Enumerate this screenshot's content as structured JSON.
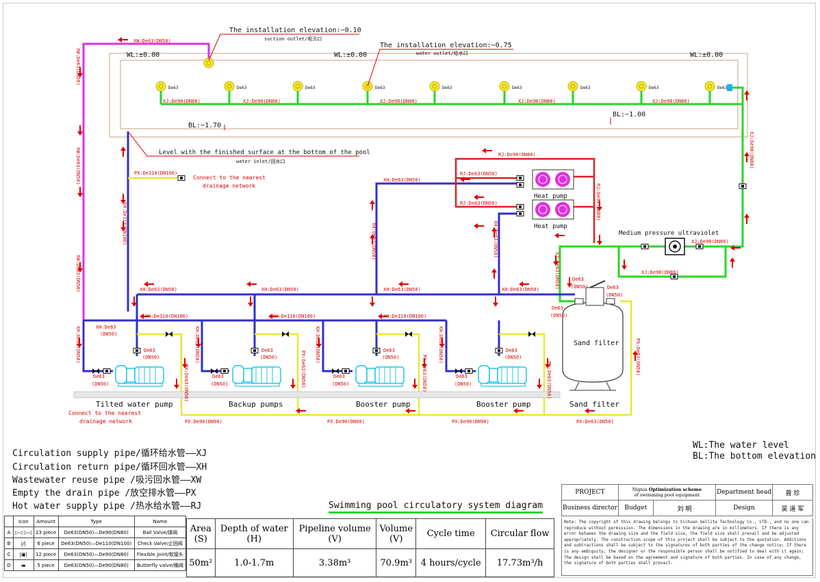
{
  "diagram": {
    "elev_suction": "The installation elevation:−0.10",
    "suction_outlet": "suction outlet/吸污口",
    "elev_water_outlet": "The installation elevation:−0.75",
    "water_outlet": "water outlet/给水口",
    "wl": "WL:±0.00",
    "bl_170": "BL:−1.70",
    "bl_100": "BL:−1.00",
    "level_note": "Level with the finished surface at the bottom of the pool",
    "water_inlet": "water inlet/回水口",
    "xw_top": "XW:De63(DN50)",
    "xw_left": "XW:De63(DN50)",
    "de63": "De63",
    "xj_de90": "XJ:De90(DN80)",
    "px_de110": "PX:De110(DN100)",
    "drain_connect": "Connect to the nearest",
    "drain_network": "drainage network",
    "rj_de90": "RJ:De90(DN80)",
    "rj_de63": "RJ:De63(DN50)",
    "heat_pump": "Heat pump",
    "uv_label": "Medium pressure ultraviolet",
    "xh_de63": "XH:De63(DN50)",
    "xh_de63_short": "XH:De63",
    "dn50": "(DN50)",
    "xh_de110": "XH:De110(DN100)",
    "xh_de110_vert": "XH:De110(DN100)",
    "xj_de63": "XJ:De63(DN50)",
    "sand_filter": "Sand filter",
    "px_de63": "PX:De63(DN50)",
    "px_de90": "PX:De90(DN90)",
    "pump_tilted": "Tilted water pump",
    "pump_backup": "Backup pumps",
    "pump_booster": "Booster pump"
  },
  "legend": [
    "Circulation supply pipe/循环给水管——XJ",
    "Circulation return pipe/循环回水管——XH",
    "Wastewater reuse pipe  /吸污回水管——XW",
    "Empty the drain pipe   /放空排水管——PX",
    "Hot water supply pipe  /热水给水管——RJ"
  ],
  "notation": {
    "wl": "WL:The water level",
    "bl": "BL:The bottom elevation"
  },
  "title": "Swimming pool circulatory system diagram",
  "components": {
    "headers": [
      "Icon",
      "Amount",
      "Type",
      "Name"
    ],
    "rows": [
      {
        "id": "A",
        "amount": "23 piece",
        "type": "De63(DN50)—De90(DN80)",
        "name": "Ball Valve/球阀"
      },
      {
        "id": "B",
        "amount": "6 piece",
        "type": "De63(DN50)—De110(DN100)",
        "name": "Check Valve/止回阀"
      },
      {
        "id": "C",
        "amount": "12 piece",
        "type": "De63(DN50)—De90(DN80)",
        "name": "Flexible Joint/软接头"
      },
      {
        "id": "D",
        "amount": "5 piece",
        "type": "De63(DN50)—De90(DN80)",
        "name": "Butterfly valve/蝶阀"
      }
    ]
  },
  "parameters": {
    "headers": [
      [
        "Area",
        "(S)"
      ],
      [
        "Depth of water",
        "(H)"
      ],
      [
        "Pipeline volume",
        "(V)"
      ],
      [
        "Volume",
        "(V)"
      ],
      [
        "Cycle time",
        ""
      ],
      [
        "Circular flow",
        ""
      ]
    ],
    "values": [
      "50m²",
      "1.0-1.7m",
      "3.38m³",
      "70.9m³",
      "4 hours/cycle",
      "17.73m³/h"
    ]
  },
  "project": {
    "project_label": "PROJECT",
    "project_name_1": "Optimization scheme",
    "project_name_2": "of swimming pool equipment",
    "project_prefix": "Nignia",
    "dept_head_label": "Department head",
    "dept_head_name": "曾   珍",
    "business_label": "Business director",
    "budget_label": "Budget",
    "budget_name": "刘   明",
    "design_label": "Design",
    "design_name": "吴 道 军"
  },
  "note": "Note: The copyright of this drawing belongs to Sichuan Gellite Technology Co., LTD., and no one can reproduce without permission. The dimensions in the drawing are in millimeters. If there is any error between the drawing size and the field size, the field size shall prevail and be adjusted appropriately. The construction scope of this project shall be subject to the quotation. Additions and subtractions shall be subject to the signatures of both parties of the change notice; If there is any ambiguity, the designer or the responsible person shall be notified to deal with it again; The design shall be based on the agreement and signature of both parties. In case of any change, the signature of both parties shall prevail.",
  "colors": {
    "xj": "#29d429",
    "xh": "#3030c8",
    "xw": "#e030e0",
    "px": "#e8e830",
    "rj": "#e02020",
    "arrow": "#e00000",
    "outlet": "#f0e020"
  }
}
